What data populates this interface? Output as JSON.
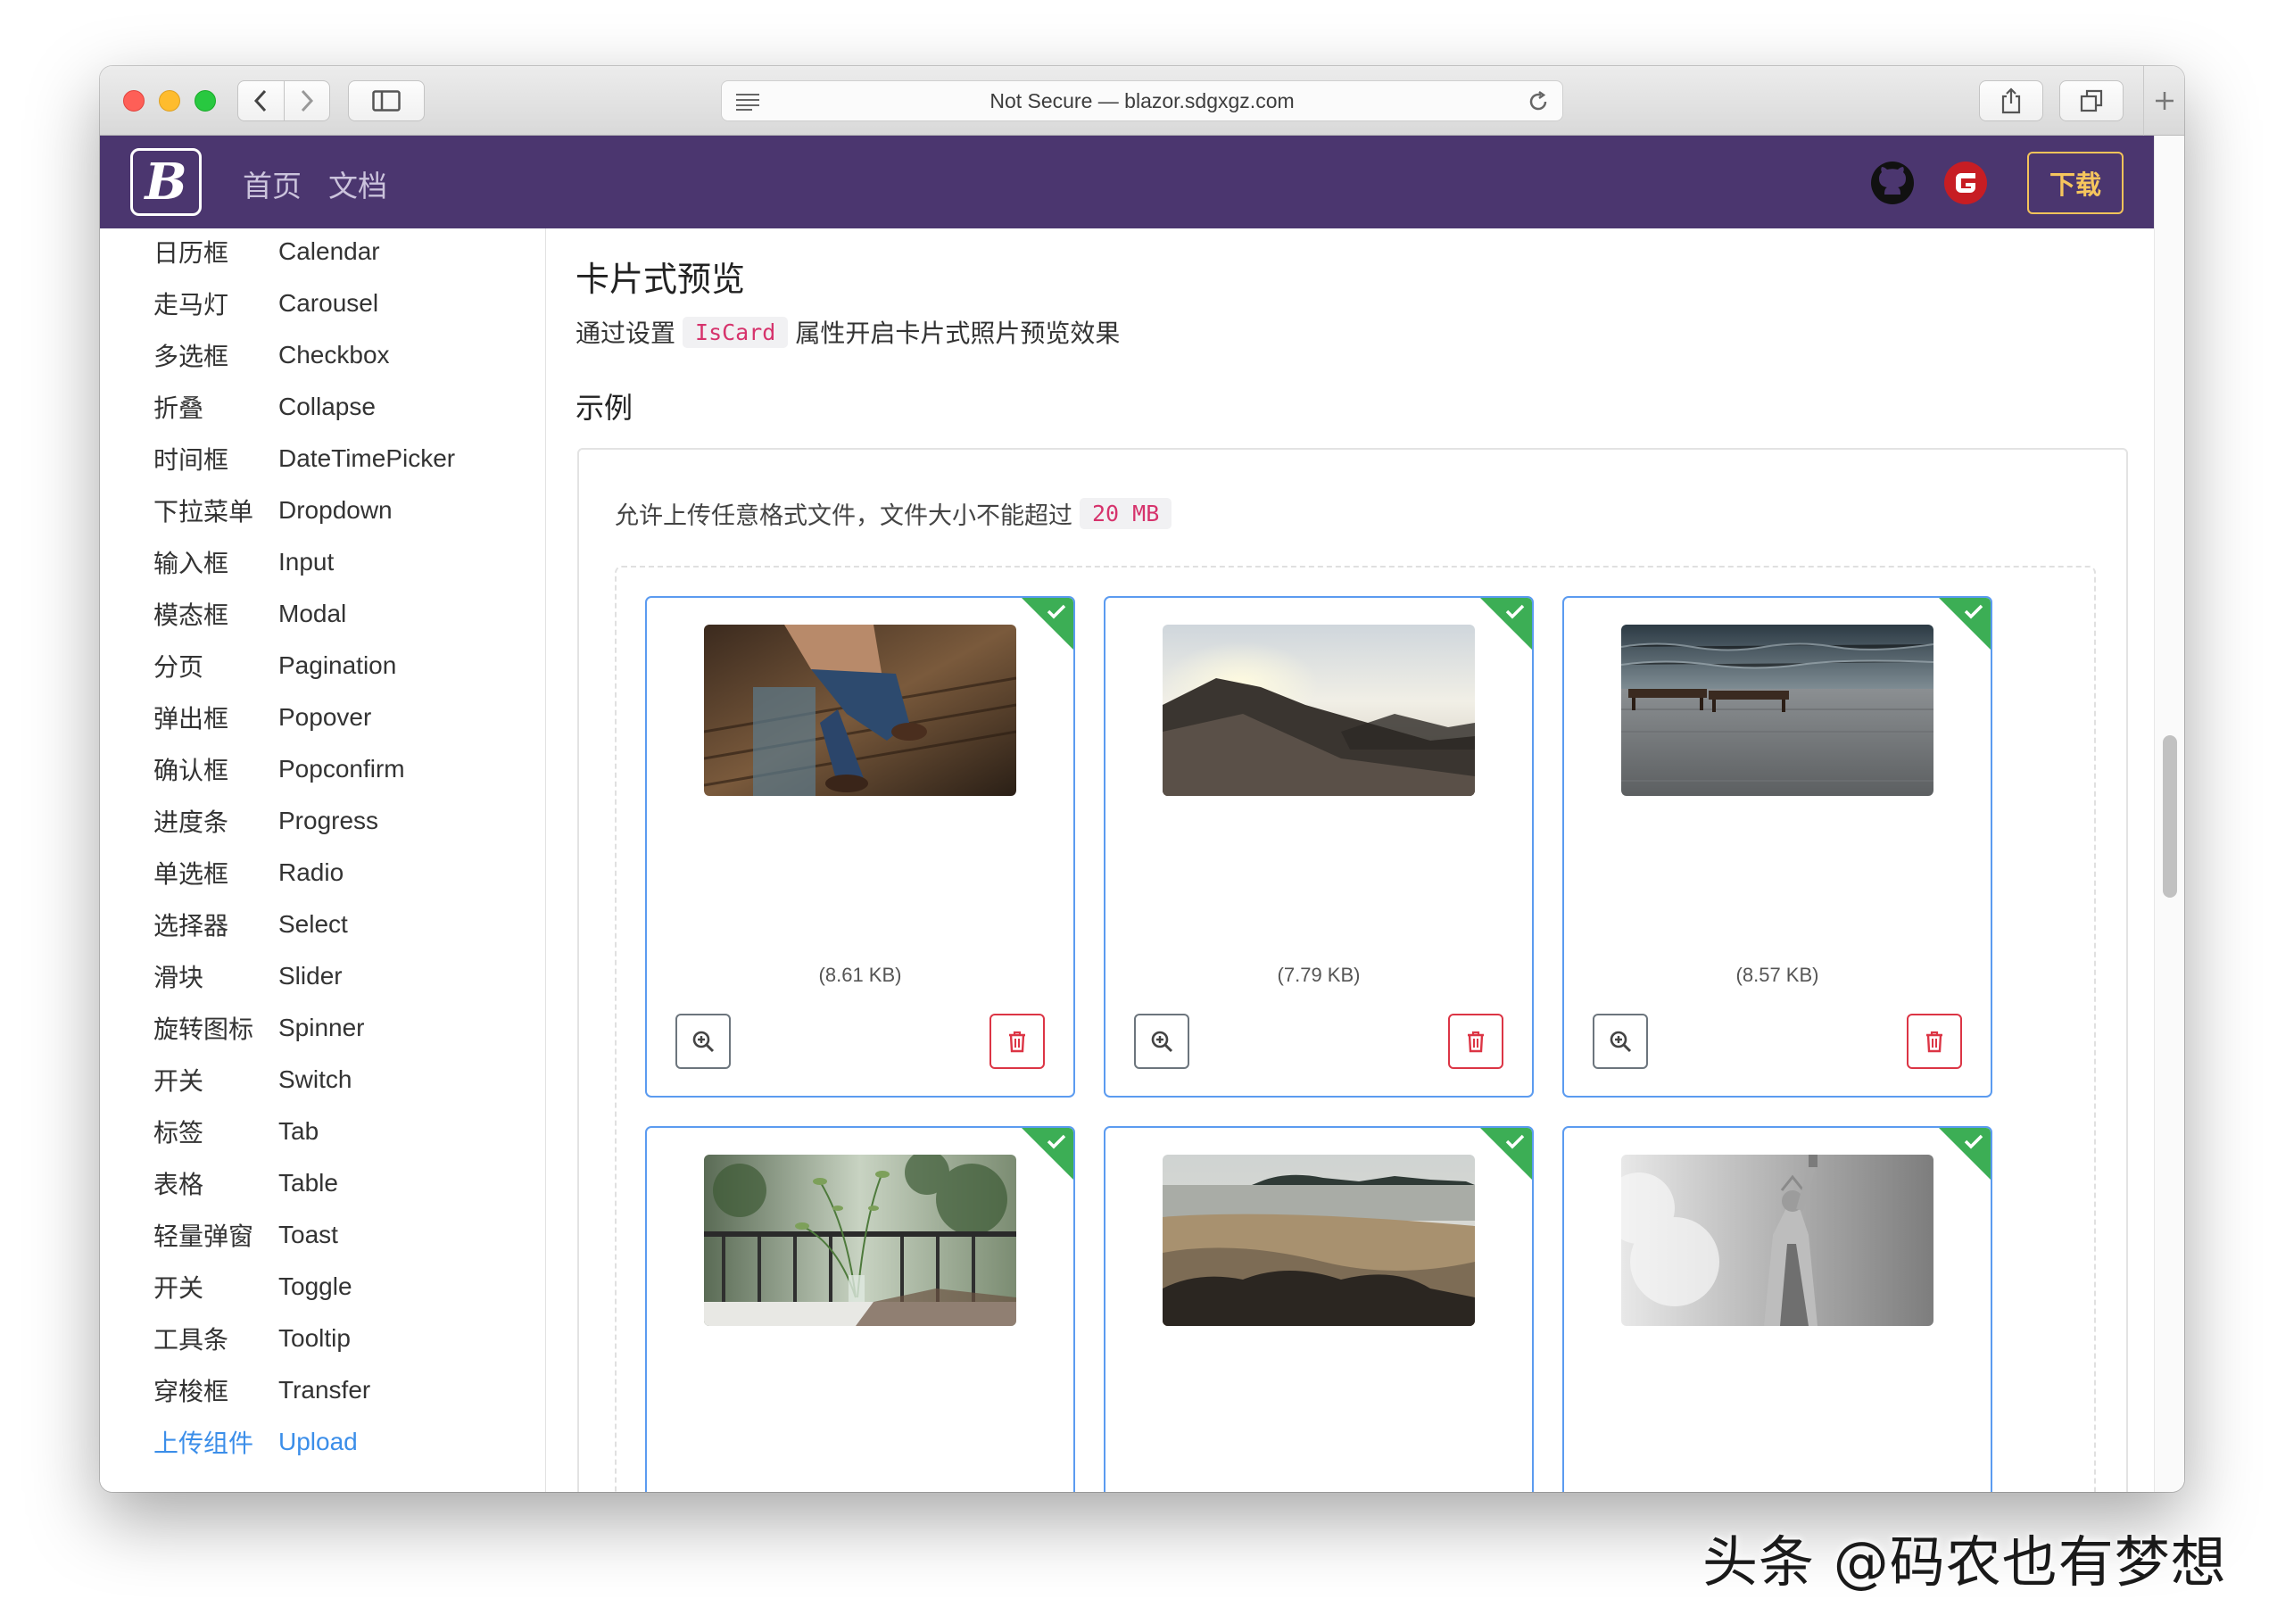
{
  "browser": {
    "address": "Not Secure — blazor.sdgxgz.com"
  },
  "navbar": {
    "logo_letter": "B",
    "links": [
      "首页",
      "文档"
    ],
    "download_label": "下载",
    "colors": {
      "bg": "#4b366f",
      "accent": "#f6c65d"
    }
  },
  "sidebar": {
    "items": [
      {
        "cn": "日历框",
        "en": "Calendar"
      },
      {
        "cn": "走马灯",
        "en": "Carousel"
      },
      {
        "cn": "多选框",
        "en": "Checkbox"
      },
      {
        "cn": "折叠",
        "en": "Collapse"
      },
      {
        "cn": "时间框",
        "en": "DateTimePicker"
      },
      {
        "cn": "下拉菜单",
        "en": "Dropdown"
      },
      {
        "cn": "输入框",
        "en": "Input"
      },
      {
        "cn": "模态框",
        "en": "Modal"
      },
      {
        "cn": "分页",
        "en": "Pagination"
      },
      {
        "cn": "弹出框",
        "en": "Popover"
      },
      {
        "cn": "确认框",
        "en": "Popconfirm"
      },
      {
        "cn": "进度条",
        "en": "Progress"
      },
      {
        "cn": "单选框",
        "en": "Radio"
      },
      {
        "cn": "选择器",
        "en": "Select"
      },
      {
        "cn": "滑块",
        "en": "Slider"
      },
      {
        "cn": "旋转图标",
        "en": "Spinner"
      },
      {
        "cn": "开关",
        "en": "Switch"
      },
      {
        "cn": "标签",
        "en": "Tab"
      },
      {
        "cn": "表格",
        "en": "Table"
      },
      {
        "cn": "轻量弹窗",
        "en": "Toast"
      },
      {
        "cn": "开关",
        "en": "Toggle"
      },
      {
        "cn": "工具条",
        "en": "Tooltip"
      },
      {
        "cn": "穿梭框",
        "en": "Transfer"
      },
      {
        "cn": "上传组件",
        "en": "Upload"
      }
    ],
    "active_index": 23
  },
  "main": {
    "title": "卡片式预览",
    "desc_before": "通过设置",
    "desc_code": "IsCard",
    "desc_after": "属性开启卡片式照片预览效果",
    "example_title": "示例",
    "hint_text": "允许上传任意格式文件，文件大小不能超过",
    "hint_code": "20 MB",
    "cards": [
      {
        "size": "(8.61 KB)",
        "image": "person-on-stool-photo"
      },
      {
        "size": "(7.79 KB)",
        "image": "mountain-sunrise-photo"
      },
      {
        "size": "(8.57 KB)",
        "image": "pier-benches-photo"
      },
      {
        "size": "",
        "image": "plant-on-balcony-photo"
      },
      {
        "size": "",
        "image": "beach-rocks-photo"
      },
      {
        "size": "",
        "image": "statue-of-liberty-photo"
      }
    ]
  },
  "watermark": "头条 @码农也有梦想"
}
